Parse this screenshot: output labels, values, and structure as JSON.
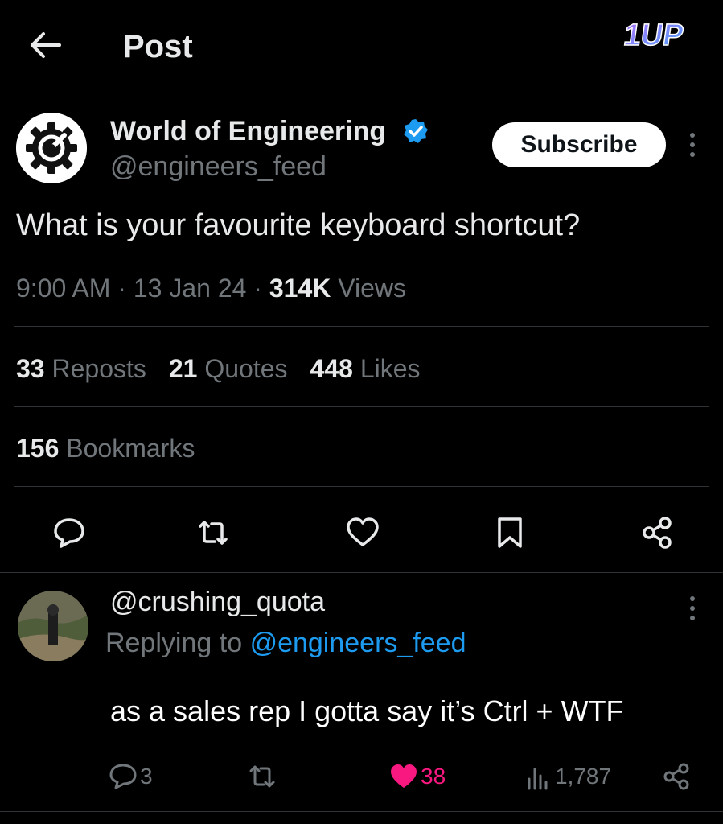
{
  "header": {
    "title": "Post",
    "logo_text": "1UP"
  },
  "post": {
    "author_name": "World of Engineering",
    "author_handle": "@engineers_feed",
    "subscribe_label": "Subscribe",
    "text": "What is your favourite keyboard shortcut?",
    "time": "9:00 AM",
    "date": "13 Jan 24",
    "views_count": "314K",
    "views_label": "Views",
    "reposts_count": "33",
    "reposts_label": "Reposts",
    "quotes_count": "21",
    "quotes_label": "Quotes",
    "likes_count": "448",
    "likes_label": "Likes",
    "bookmarks_count": "156",
    "bookmarks_label": "Bookmarks"
  },
  "reply": {
    "handle": "@crushing_quota",
    "replying_prefix": "Replying to",
    "replying_mention": "@engineers_feed",
    "text": "as a sales rep I gotta say it’s Ctrl + WTF",
    "reply_count": "3",
    "like_count": "38",
    "views_count": "1,787"
  },
  "colors": {
    "background": "#000000",
    "text_primary": "#e7e9ea",
    "text_secondary": "#71767b",
    "link_blue": "#1d9bf0",
    "like_pink": "#f91880",
    "divider": "#2f3336"
  },
  "icons": {
    "back": "arrow-left-icon",
    "verified": "verified-badge-icon",
    "more": "more-vertical-icon",
    "reply": "comment-icon",
    "repost": "repost-icon",
    "like": "heart-icon",
    "bookmark": "bookmark-icon",
    "share": "share-icon",
    "views": "bar-chart-icon"
  }
}
